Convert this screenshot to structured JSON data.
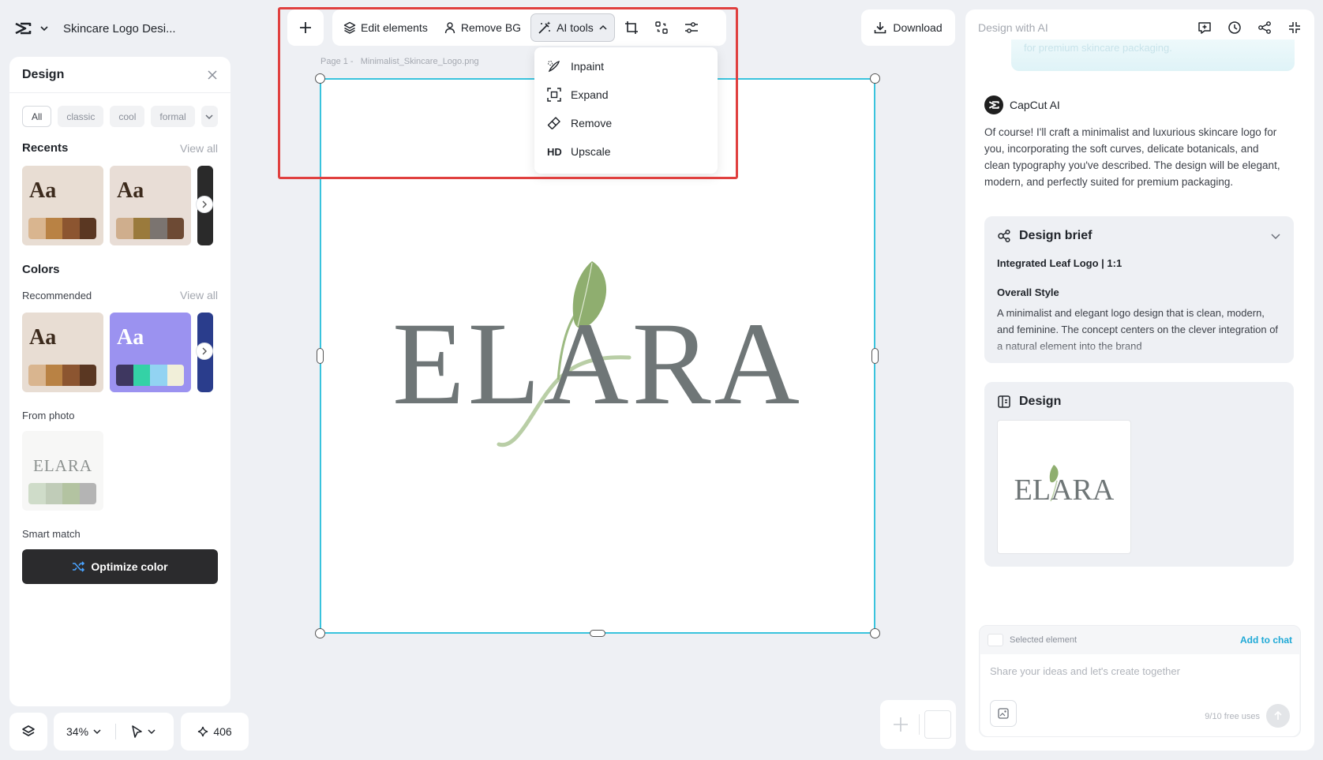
{
  "app": {
    "title": "Skincare Logo Desi..."
  },
  "left_panel": {
    "title": "Design",
    "chips": [
      "All",
      "classic",
      "cool",
      "formal"
    ],
    "recents": {
      "heading": "Recents",
      "view_all": "View all"
    },
    "colors": {
      "heading": "Colors",
      "recommended": "Recommended",
      "view_all": "View all"
    },
    "sample_text": "Aa",
    "palettes": [
      {
        "bg": "#e8ddd3",
        "text": "#3c2a1c",
        "swatches": [
          "#d9b58f",
          "#b98244",
          "#8c5530",
          "#5a3722"
        ]
      },
      {
        "bg": "#e8ddd6",
        "text": "#3c2a1c",
        "swatches": [
          "#cfae8d",
          "#9a7a3c",
          "#7b7470",
          "#6d4a34"
        ]
      },
      {
        "bg": "#e8ddd3",
        "text": "#3c2a1c",
        "swatches": [
          "#d9b58f",
          "#b98244",
          "#8c5530",
          "#5a3722"
        ]
      },
      {
        "bg": "#9b92f0",
        "text": "#ffffff",
        "swatches": [
          "#3e3760",
          "#34d2a6",
          "#92d3f2",
          "#f1efd9"
        ]
      }
    ],
    "from_photo": {
      "label": "From photo",
      "logo_text": "ELARA",
      "swatches": [
        "#cfdcc9",
        "#c0ccb8",
        "#b3c3a1",
        "#b4b4b4"
      ]
    },
    "smart_match": "Smart match",
    "optimize_button": "Optimize color"
  },
  "bottom_bar": {
    "zoom": "34%",
    "credits": "406"
  },
  "toolbar": {
    "edit_elements": "Edit elements",
    "remove_bg": "Remove BG",
    "ai_tools": "AI tools",
    "download": "Download"
  },
  "ai_tools_menu": [
    {
      "label": "Inpaint",
      "icon": "inpaint-icon"
    },
    {
      "label": "Expand",
      "icon": "expand-icon"
    },
    {
      "label": "Remove",
      "icon": "eraser-icon"
    },
    {
      "label": "Upscale",
      "icon": "hd-icon",
      "prefix": "HD"
    }
  ],
  "canvas": {
    "page_label": "Page 1 -",
    "file_name": "Minimalist_Skincare_Logo.png",
    "logo_text": "ELARA",
    "colors": {
      "text": "#6f7677",
      "leaf": "#8fae6f",
      "stem": "#b7cba3",
      "selection": "#39c3dd"
    }
  },
  "right_panel": {
    "title": "Design with AI",
    "prev_message": "for premium skincare packaging.",
    "ai_name": "CapCut AI",
    "ai_message": "Of course! I'll craft a minimalist and luxurious skincare logo for you, incorporating the soft curves, delicate botanicals, and clean typography you've described. The design will be elegant, modern, and perfectly suited for premium packaging.",
    "brief": {
      "title": "Design brief",
      "subtitle": "Integrated Leaf Logo | 1:1",
      "style_heading": "Overall Style",
      "style_text": "A minimalist and elegant logo design that is clean, modern, and feminine. The concept centers on the clever integration of a natural element into the brand"
    },
    "design": {
      "title": "Design",
      "logo_text": "ELARA"
    },
    "chat": {
      "selected": "Selected element",
      "add": "Add to chat",
      "placeholder": "Share your ideas and let's create together",
      "free_uses": "9/10 free uses"
    }
  }
}
